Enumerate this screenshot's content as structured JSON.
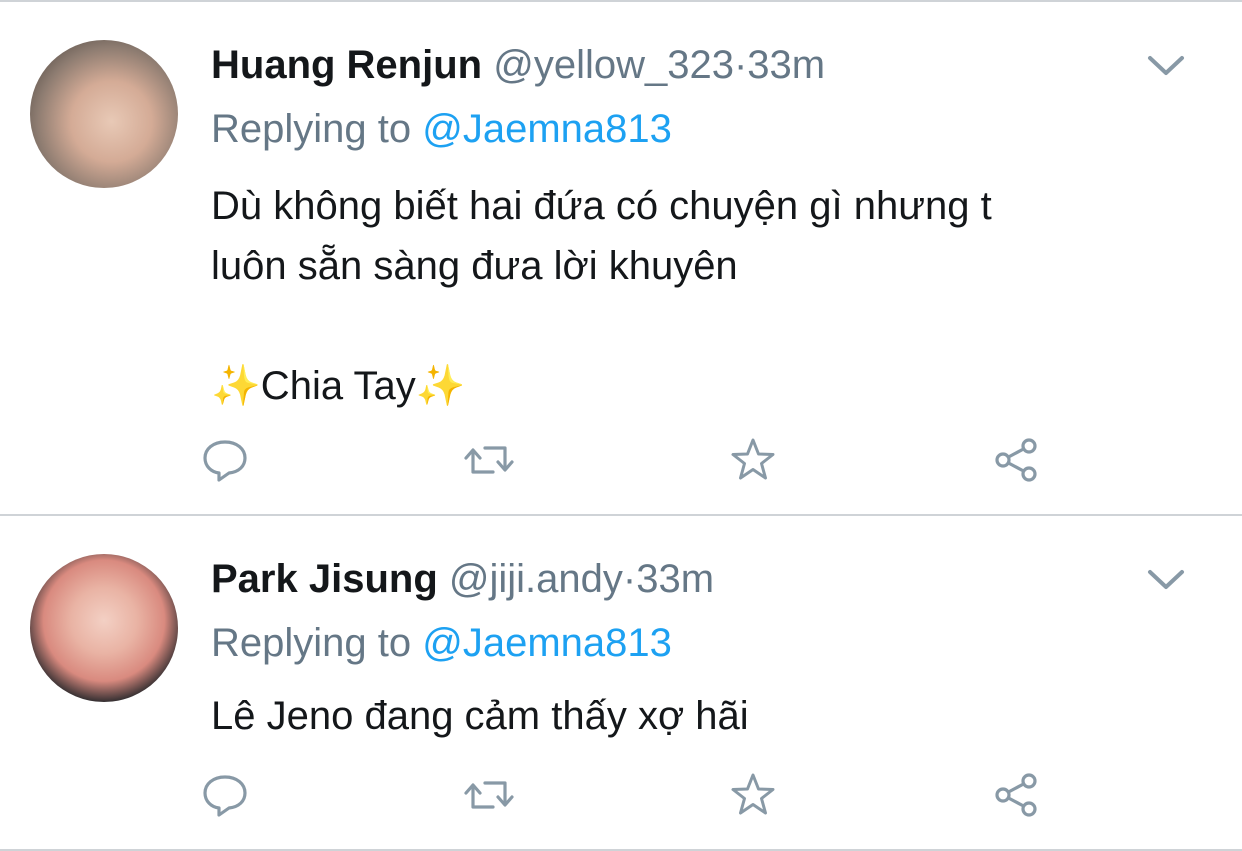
{
  "tweets": [
    {
      "name": "Huang Renjun",
      "handle": "@yellow_323",
      "dot": "·",
      "time": "33m",
      "replying_prefix": "Replying to ",
      "replying_to": "@Jaemna813",
      "body": "Dù không biết hai đứa có chuyện gì nhưng t\nluôn sẵn sàng đưa lời khuyên\n\n✨Chia Tay✨"
    },
    {
      "name": "Park Jisung",
      "handle": "@jiji.andy",
      "dot": "·",
      "time": "33m",
      "replying_prefix": "Replying to ",
      "replying_to": "@Jaemna813",
      "body": "Lê Jeno đang cảm thấy xợ hãi"
    }
  ],
  "icons": {
    "reply": "reply-bubble-icon",
    "retweet": "retweet-icon",
    "like": "star-icon",
    "share": "share-icon",
    "menu": "chevron-down-icon"
  },
  "colors": {
    "text": "#14171a",
    "muted": "#657786",
    "accent": "#1da1f2",
    "icon": "#8899a6",
    "divider": "#cfd3d7"
  }
}
